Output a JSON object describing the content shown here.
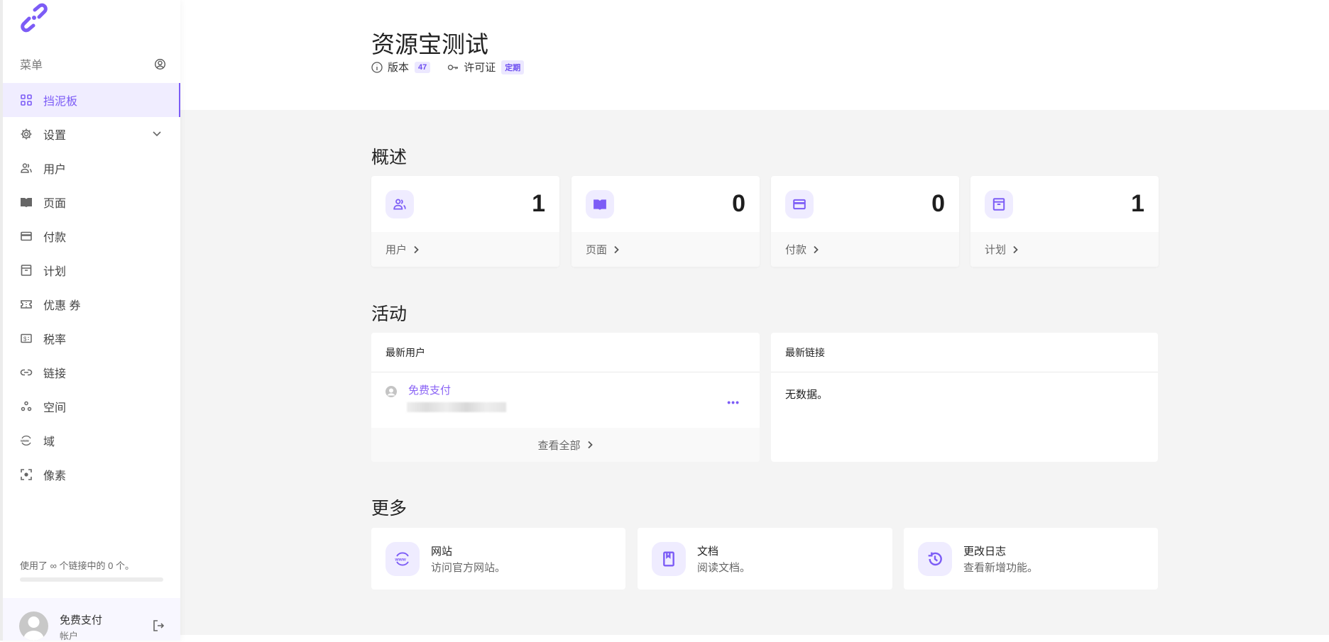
{
  "sidebar": {
    "menu_label": "菜单",
    "items": [
      {
        "label": "挡泥板",
        "icon": "grid-icon",
        "active": true
      },
      {
        "label": "设置",
        "icon": "gear-icon"
      },
      {
        "label": "用户",
        "icon": "users-icon"
      },
      {
        "label": "页面",
        "icon": "book-icon"
      },
      {
        "label": "付款",
        "icon": "credit-card-icon"
      },
      {
        "label": "计划",
        "icon": "box-icon"
      },
      {
        "label": "优惠 券",
        "icon": "ticket-icon"
      },
      {
        "label": "税率",
        "icon": "receipt-icon"
      },
      {
        "label": "链接",
        "icon": "link-icon"
      },
      {
        "label": "空间",
        "icon": "spaces-icon"
      },
      {
        "label": "域",
        "icon": "www-icon"
      },
      {
        "label": "像素",
        "icon": "pixel-icon"
      }
    ],
    "usage_text": "使用了 ∞ 个链接中的 0 个。",
    "usage_fraction": 0,
    "user": {
      "name": "免费支付",
      "role": "帐户"
    }
  },
  "header": {
    "title": "资源宝测试",
    "version_label": "版本",
    "version": "47",
    "license_label": "许可证",
    "license": "定期"
  },
  "overview": {
    "title": "概述",
    "stats": [
      {
        "label": "用户",
        "value": "1"
      },
      {
        "label": "页面",
        "value": "0"
      },
      {
        "label": "付款",
        "value": "0"
      },
      {
        "label": "计划",
        "value": "1"
      }
    ]
  },
  "activity": {
    "title": "活动",
    "latest_users": {
      "title": "最新用户",
      "user_name": "免费支付",
      "view_all": "查看全部"
    },
    "latest_links": {
      "title": "最新链接",
      "empty": "无数据。"
    }
  },
  "more": {
    "title": "更多",
    "items": [
      {
        "title": "网站",
        "desc": "访问官方网站。"
      },
      {
        "title": "文档",
        "desc": "阅读文档。"
      },
      {
        "title": "更改日志",
        "desc": "查看新增功能。"
      }
    ]
  },
  "colors": {
    "accent": "#7c5cf6",
    "accent_bg": "#efecff",
    "bg": "#f4f4f4"
  }
}
